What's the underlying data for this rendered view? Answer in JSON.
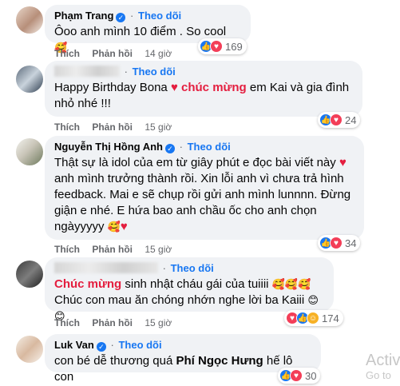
{
  "follow_label": "Theo dõi",
  "like_label": "Thích",
  "reply_label": "Phản hồi",
  "colors": {
    "accent": "#1877f2",
    "heart": "#e41e3f",
    "bubble": "#f0f2f5"
  },
  "comments": [
    {
      "name": "Phạm Trang",
      "text": "Ôoo anh mình 10 điểm . So cool",
      "time": "14 giờ",
      "reactions": [
        "like-icon",
        "love-icon"
      ],
      "count": "169"
    },
    {
      "name": "",
      "text_a": "Happy Birthday Bona",
      "text_b": "chúc mừng",
      "text_c": "em Kai và gia đình",
      "text_d": "nhỏ nhé !!!",
      "time": "15 giờ",
      "reactions": [
        "like-icon",
        "love-icon"
      ],
      "count": "24"
    },
    {
      "name": "Nguyễn Thị Hồng Anh",
      "line1": "Thật sự là idol của em từ giây phút e đọc bài viết này",
      "line2": "anh mình trưởng thành rồi. Xin lỗi anh vì chưa trả hình",
      "line3": "feedback. Mai e sẽ chụp rồi gửi anh mình lunnnn. Đừng",
      "line4": "giận e nhé. E hứa bao anh chầu ốc cho anh chọn",
      "line5": "ngàyyyyy",
      "time": "15 giờ",
      "reactions": [
        "like-icon",
        "love-icon"
      ],
      "count": "34"
    },
    {
      "name": "",
      "line1_a": "Chúc mừng",
      "line1_b": "sinh nhật cháu gái của tuiiii",
      "line2": "Chúc con mau ăn chóng nhớn nghe lời ba Kaiii",
      "time": "15 giờ",
      "reactions": [
        "love-icon",
        "like-icon",
        "care-icon"
      ],
      "count": "174"
    },
    {
      "name": "Luk Van",
      "text_a": "con bé dễ thương quá",
      "text_b": "Phí Ngọc Hưng",
      "text_c": "hế lô con",
      "reactions": [
        "like-icon",
        "love-icon"
      ],
      "count": "30"
    }
  ],
  "watermark": {
    "line1": "Activ",
    "line2": "Go to"
  }
}
